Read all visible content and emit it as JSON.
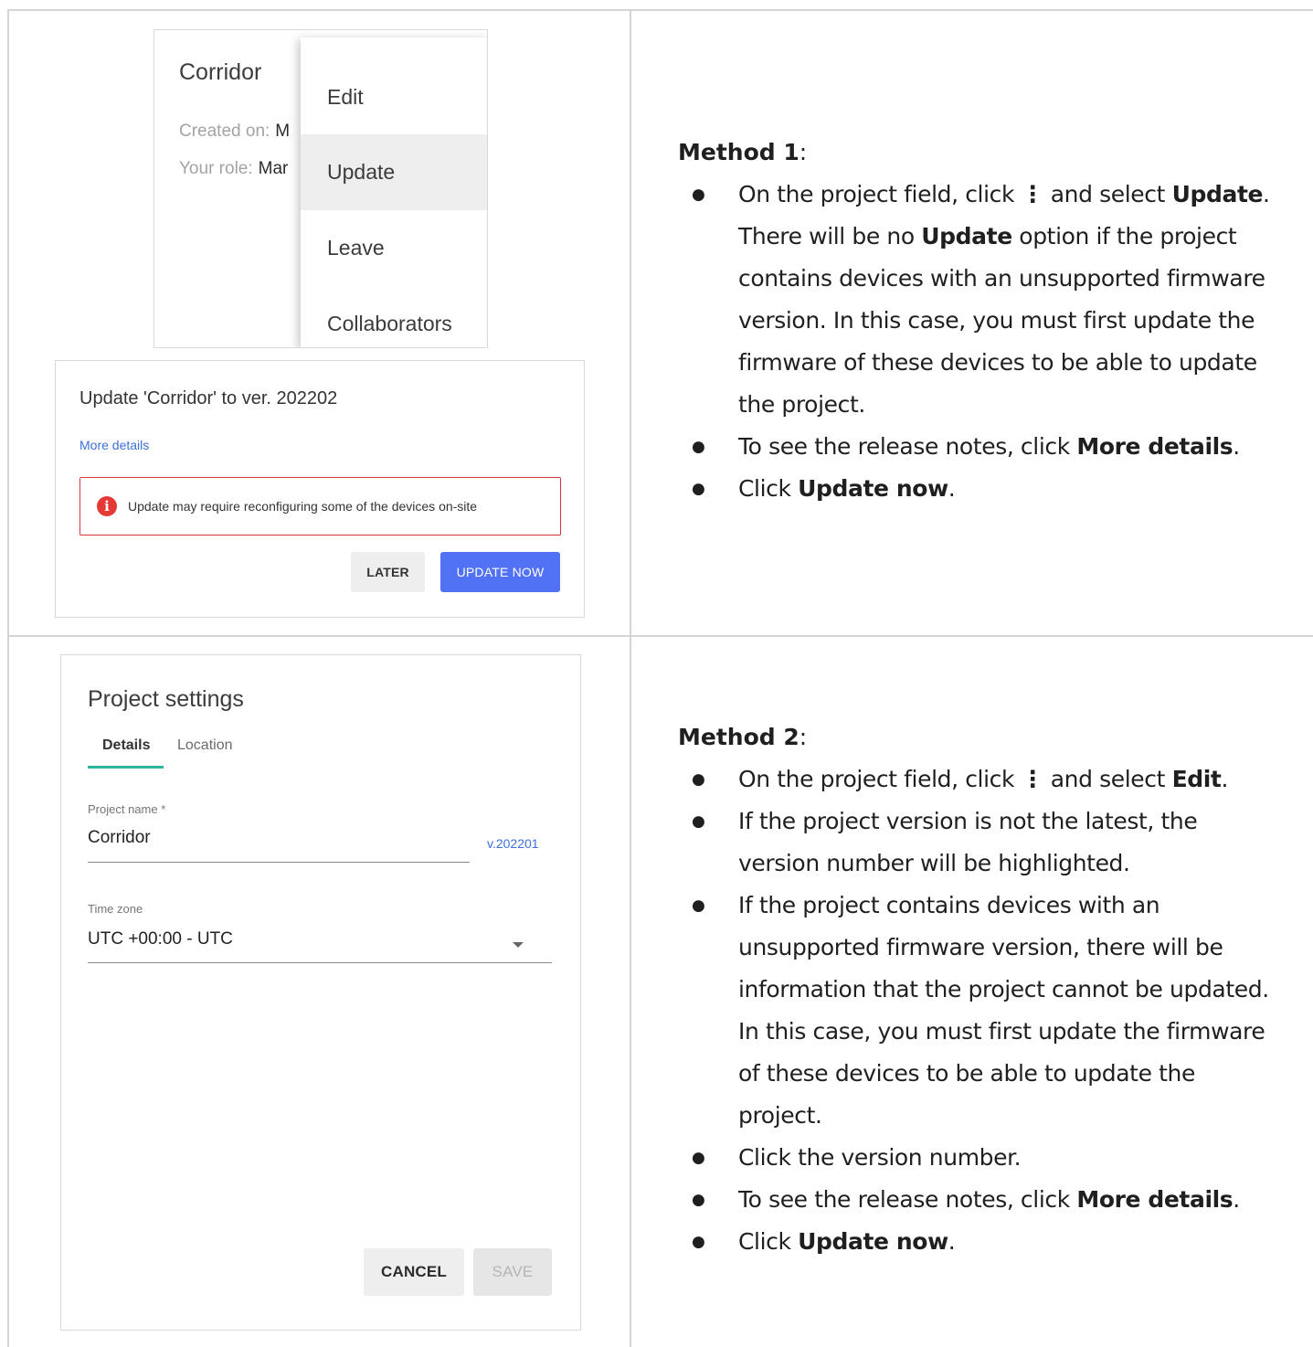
{
  "project_card": {
    "name": "Corridor",
    "created_label": "Created on:",
    "created_value": "M",
    "role_label": "Your role:",
    "role_value": "Mar",
    "menu": [
      "Edit",
      "Update",
      "Leave",
      "Collaborators"
    ]
  },
  "update_dialog": {
    "title": "Update 'Corridor' to ver. 202202",
    "more_details": "More details",
    "warning": "Update may require reconfiguring some of the devices on-site",
    "later_button": "LATER",
    "update_button": "UPDATE NOW"
  },
  "project_settings": {
    "title": "Project settings",
    "tabs": [
      "Details",
      "Location"
    ],
    "name_label": "Project name *",
    "name_value": "Corridor",
    "version": "v.202201",
    "timezone_label": "Time zone",
    "timezone_value": "UTC +00:00 - UTC",
    "cancel_button": "CANCEL",
    "save_button": "SAVE"
  },
  "method1": {
    "title": "Method 1",
    "b1_pre": "On the project field, click ",
    "kebab": "⋮",
    "b1_mid": " and select ",
    "b1_bold": "Update",
    "b1_post": ".",
    "b1_p2_pre": "There will be no ",
    "b1_p2_bold": "Update",
    "b1_p2_post": " option if the project contains devices with an unsupported firmware version. In this case, you must first update the firmware of these devices to be able to update the project.",
    "b2_pre": "To see the release notes, click ",
    "b2_bold": "More details",
    "b2_post": ".",
    "b3_pre": "Click ",
    "b3_bold": "Update now",
    "b3_post": "."
  },
  "method2": {
    "title": "Method 2",
    "b1_pre": "On the project field, click ",
    "kebab": "⋮",
    "b1_mid": " and select ",
    "b1_bold": "Edit",
    "b1_post": ".",
    "b2": "If the project version is not the latest, the version number will be highlighted.",
    "b3": "If the project contains devices with an unsupported firmware version, there will be information that the project cannot be updated. In this case, you must first update the firmware of these devices to be able to update the project.",
    "b4": "Click the version number.",
    "b5_pre": "To see the release notes, click ",
    "b5_bold": "More details",
    "b5_post": ".",
    "b6_pre": "Click ",
    "b6_bold": "Update now",
    "b6_post": "."
  }
}
